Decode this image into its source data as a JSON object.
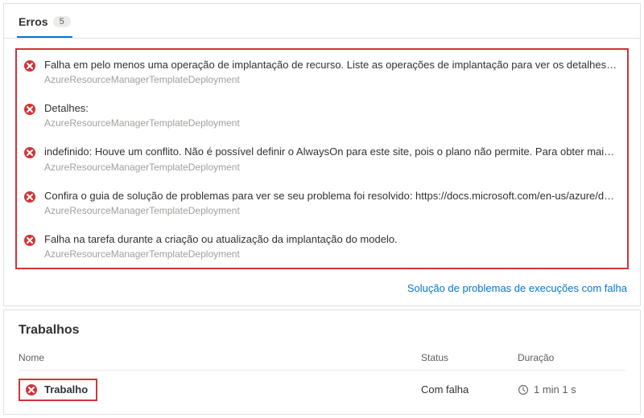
{
  "tab": {
    "label": "Erros",
    "count": "5"
  },
  "errors": [
    {
      "message": "Falha em pelo menos uma operação de implantação de recurso. Liste as operações de implantação para ver os detalhes. Confira http://aka.ms...",
      "source": "AzureResourceManagerTemplateDeployment"
    },
    {
      "message": "Detalhes:",
      "source": "AzureResourceManagerTemplateDeployment"
    },
    {
      "message": "indefinido: Houve um conflito. Não é possível definir o AlwaysOn para este site, pois o plano não permite. Para obter mais informações sobre pr...",
      "source": "AzureResourceManagerTemplateDeployment"
    },
    {
      "message": "Confira o guia de solução de problemas para ver se seu problema foi resolvido: https://docs.microsoft.com/en-us/azure/devops/pipeline/tasks/...",
      "source": "AzureResourceManagerTemplateDeployment"
    },
    {
      "message": "Falha na tarefa durante a criação ou atualização da implantação do modelo.",
      "source": "AzureResourceManagerTemplateDeployment"
    }
  ],
  "troubleshoot_link": "Solução de problemas de execuções com falha",
  "jobs": {
    "title": "Trabalhos",
    "columns": {
      "name": "Nome",
      "status": "Status",
      "duration": "Duração"
    },
    "rows": [
      {
        "name": "Trabalho",
        "status": "Com falha",
        "duration": "1 min 1 s"
      }
    ]
  }
}
